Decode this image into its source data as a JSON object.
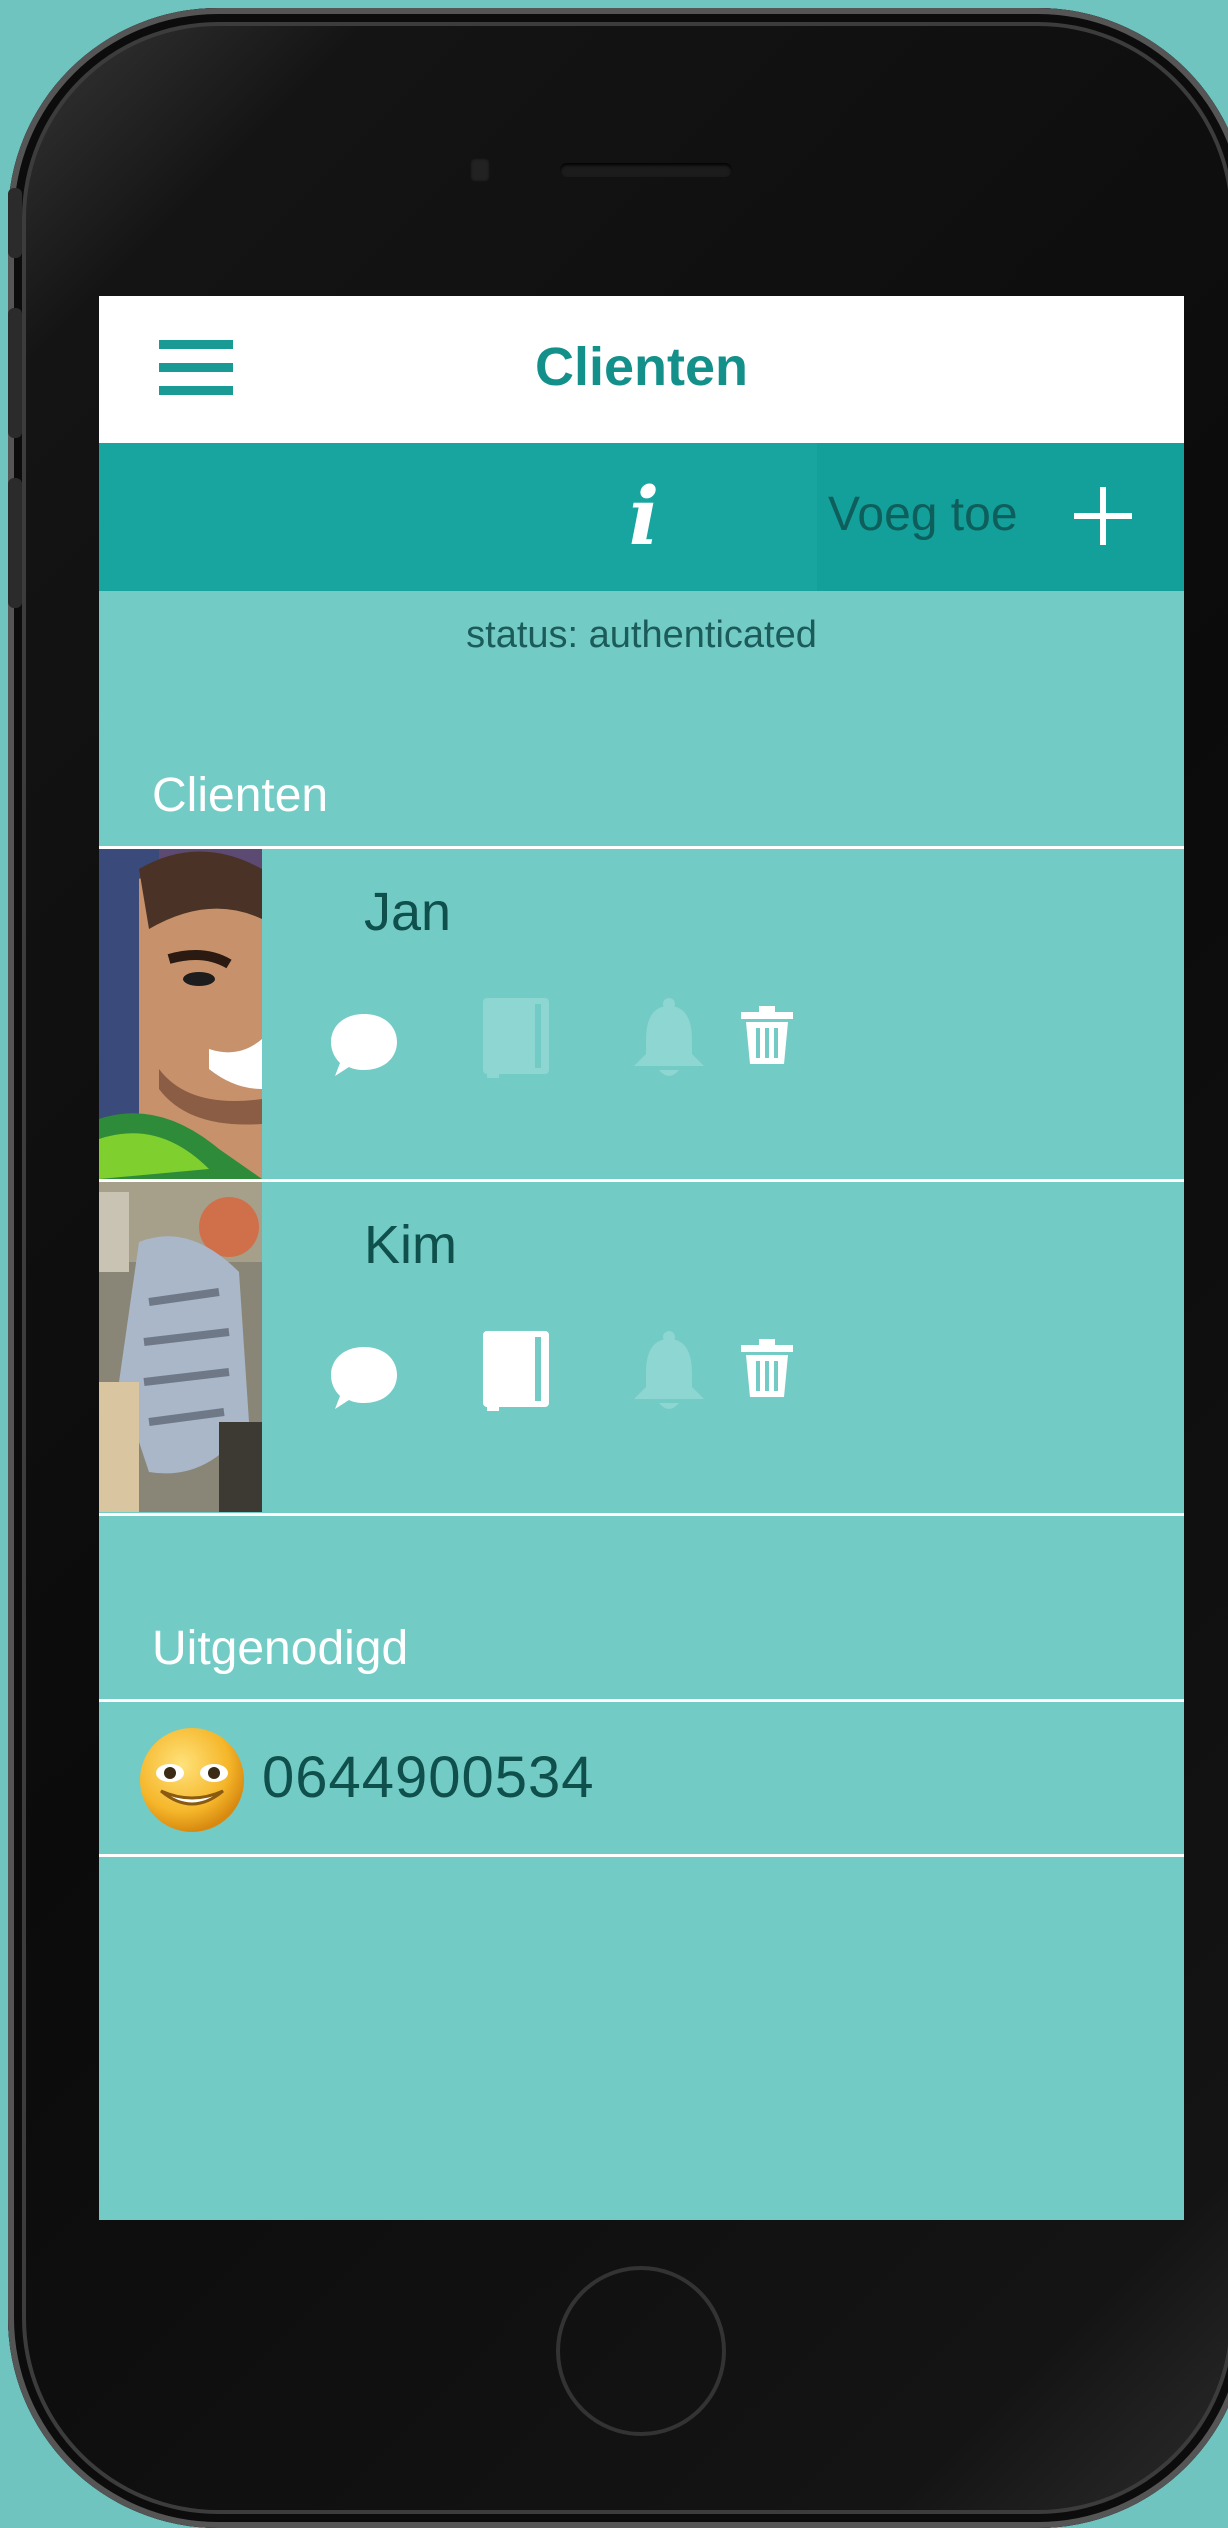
{
  "header": {
    "title": "Clienten"
  },
  "toolbar": {
    "info_label": "i",
    "add_label": "Voeg toe"
  },
  "status": "status: authenticated",
  "clients_section": {
    "label": "Clienten",
    "items": [
      {
        "name": "Jan",
        "actions": {
          "chat": "chat-bubble-icon",
          "diary": "book-icon",
          "notify": "bell-icon",
          "delete": "trash-icon"
        },
        "diary_enabled": false
      },
      {
        "name": "Kim",
        "actions": {
          "chat": "chat-bubble-icon",
          "diary": "book-icon",
          "notify": "bell-icon",
          "delete": "trash-icon"
        },
        "diary_enabled": true
      }
    ]
  },
  "invited_section": {
    "label": "Uitgenodigd",
    "items": [
      {
        "phone": "0644900534",
        "avatar": "smiley-emoji-icon"
      }
    ]
  },
  "colors": {
    "screen_bg": "#73cbc6",
    "toolbar": "#18a5a0",
    "accent": "#14908b",
    "text_dark": "#0f4f4c",
    "disabled_icon": "#8dd6d2",
    "page_bg": "#6fc4c0"
  }
}
